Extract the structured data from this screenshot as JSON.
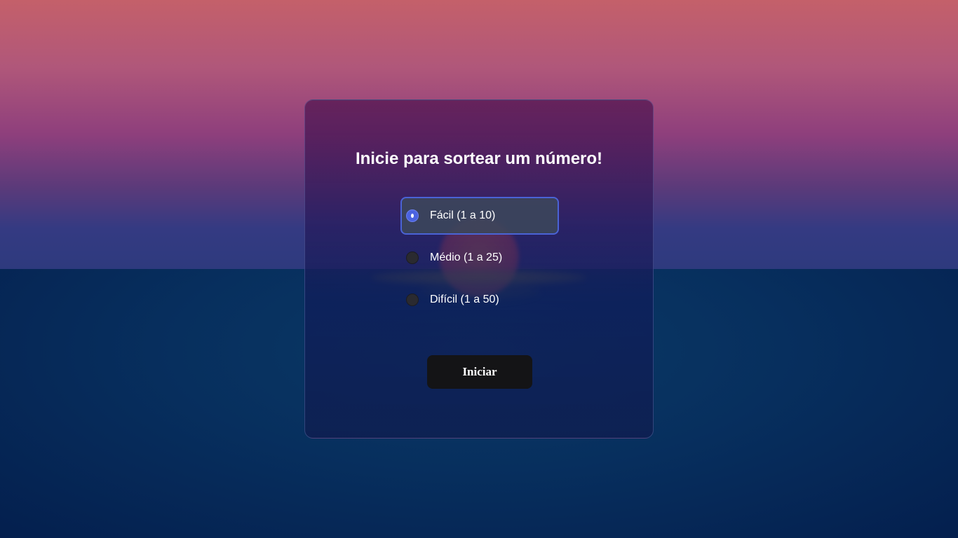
{
  "page": {
    "title": "Inicie para sortear um número!"
  },
  "difficulty": {
    "options": [
      {
        "label": "Fácil (1 a 10)",
        "selected": true
      },
      {
        "label": "Médio (1 a 25)",
        "selected": false
      },
      {
        "label": "Difícil (1 a 50)",
        "selected": false
      }
    ]
  },
  "actions": {
    "start_label": "Iniciar"
  },
  "colors": {
    "accent": "#4a63d6",
    "button_bg": "#141416",
    "text": "#ffffff"
  }
}
